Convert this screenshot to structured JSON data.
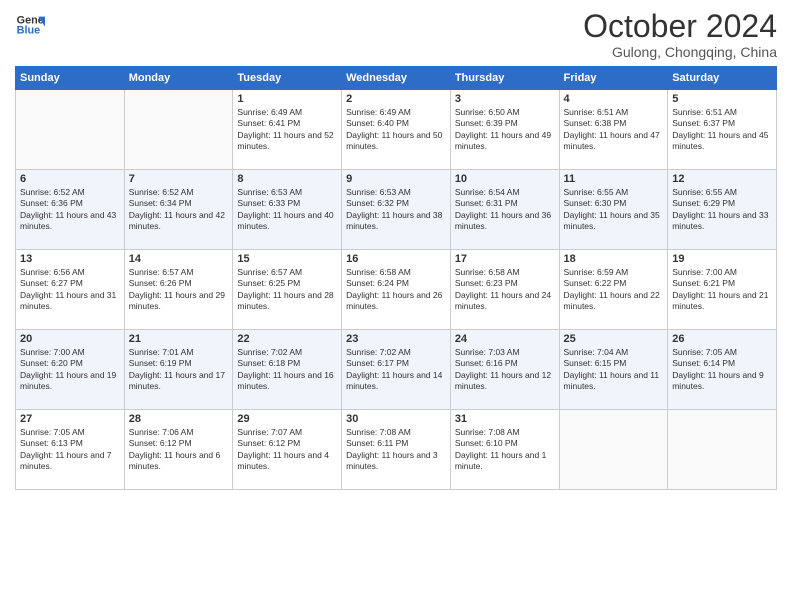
{
  "header": {
    "logo_line1": "General",
    "logo_line2": "Blue",
    "month": "October 2024",
    "location": "Gulong, Chongqing, China"
  },
  "weekdays": [
    "Sunday",
    "Monday",
    "Tuesday",
    "Wednesday",
    "Thursday",
    "Friday",
    "Saturday"
  ],
  "weeks": [
    [
      {
        "day": "",
        "text": ""
      },
      {
        "day": "",
        "text": ""
      },
      {
        "day": "1",
        "text": "Sunrise: 6:49 AM\nSunset: 6:41 PM\nDaylight: 11 hours and 52 minutes."
      },
      {
        "day": "2",
        "text": "Sunrise: 6:49 AM\nSunset: 6:40 PM\nDaylight: 11 hours and 50 minutes."
      },
      {
        "day": "3",
        "text": "Sunrise: 6:50 AM\nSunset: 6:39 PM\nDaylight: 11 hours and 49 minutes."
      },
      {
        "day": "4",
        "text": "Sunrise: 6:51 AM\nSunset: 6:38 PM\nDaylight: 11 hours and 47 minutes."
      },
      {
        "day": "5",
        "text": "Sunrise: 6:51 AM\nSunset: 6:37 PM\nDaylight: 11 hours and 45 minutes."
      }
    ],
    [
      {
        "day": "6",
        "text": "Sunrise: 6:52 AM\nSunset: 6:36 PM\nDaylight: 11 hours and 43 minutes."
      },
      {
        "day": "7",
        "text": "Sunrise: 6:52 AM\nSunset: 6:34 PM\nDaylight: 11 hours and 42 minutes."
      },
      {
        "day": "8",
        "text": "Sunrise: 6:53 AM\nSunset: 6:33 PM\nDaylight: 11 hours and 40 minutes."
      },
      {
        "day": "9",
        "text": "Sunrise: 6:53 AM\nSunset: 6:32 PM\nDaylight: 11 hours and 38 minutes."
      },
      {
        "day": "10",
        "text": "Sunrise: 6:54 AM\nSunset: 6:31 PM\nDaylight: 11 hours and 36 minutes."
      },
      {
        "day": "11",
        "text": "Sunrise: 6:55 AM\nSunset: 6:30 PM\nDaylight: 11 hours and 35 minutes."
      },
      {
        "day": "12",
        "text": "Sunrise: 6:55 AM\nSunset: 6:29 PM\nDaylight: 11 hours and 33 minutes."
      }
    ],
    [
      {
        "day": "13",
        "text": "Sunrise: 6:56 AM\nSunset: 6:27 PM\nDaylight: 11 hours and 31 minutes."
      },
      {
        "day": "14",
        "text": "Sunrise: 6:57 AM\nSunset: 6:26 PM\nDaylight: 11 hours and 29 minutes."
      },
      {
        "day": "15",
        "text": "Sunrise: 6:57 AM\nSunset: 6:25 PM\nDaylight: 11 hours and 28 minutes."
      },
      {
        "day": "16",
        "text": "Sunrise: 6:58 AM\nSunset: 6:24 PM\nDaylight: 11 hours and 26 minutes."
      },
      {
        "day": "17",
        "text": "Sunrise: 6:58 AM\nSunset: 6:23 PM\nDaylight: 11 hours and 24 minutes."
      },
      {
        "day": "18",
        "text": "Sunrise: 6:59 AM\nSunset: 6:22 PM\nDaylight: 11 hours and 22 minutes."
      },
      {
        "day": "19",
        "text": "Sunrise: 7:00 AM\nSunset: 6:21 PM\nDaylight: 11 hours and 21 minutes."
      }
    ],
    [
      {
        "day": "20",
        "text": "Sunrise: 7:00 AM\nSunset: 6:20 PM\nDaylight: 11 hours and 19 minutes."
      },
      {
        "day": "21",
        "text": "Sunrise: 7:01 AM\nSunset: 6:19 PM\nDaylight: 11 hours and 17 minutes."
      },
      {
        "day": "22",
        "text": "Sunrise: 7:02 AM\nSunset: 6:18 PM\nDaylight: 11 hours and 16 minutes."
      },
      {
        "day": "23",
        "text": "Sunrise: 7:02 AM\nSunset: 6:17 PM\nDaylight: 11 hours and 14 minutes."
      },
      {
        "day": "24",
        "text": "Sunrise: 7:03 AM\nSunset: 6:16 PM\nDaylight: 11 hours and 12 minutes."
      },
      {
        "day": "25",
        "text": "Sunrise: 7:04 AM\nSunset: 6:15 PM\nDaylight: 11 hours and 11 minutes."
      },
      {
        "day": "26",
        "text": "Sunrise: 7:05 AM\nSunset: 6:14 PM\nDaylight: 11 hours and 9 minutes."
      }
    ],
    [
      {
        "day": "27",
        "text": "Sunrise: 7:05 AM\nSunset: 6:13 PM\nDaylight: 11 hours and 7 minutes."
      },
      {
        "day": "28",
        "text": "Sunrise: 7:06 AM\nSunset: 6:12 PM\nDaylight: 11 hours and 6 minutes."
      },
      {
        "day": "29",
        "text": "Sunrise: 7:07 AM\nSunset: 6:12 PM\nDaylight: 11 hours and 4 minutes."
      },
      {
        "day": "30",
        "text": "Sunrise: 7:08 AM\nSunset: 6:11 PM\nDaylight: 11 hours and 3 minutes."
      },
      {
        "day": "31",
        "text": "Sunrise: 7:08 AM\nSunset: 6:10 PM\nDaylight: 11 hours and 1 minute."
      },
      {
        "day": "",
        "text": ""
      },
      {
        "day": "",
        "text": ""
      }
    ]
  ]
}
